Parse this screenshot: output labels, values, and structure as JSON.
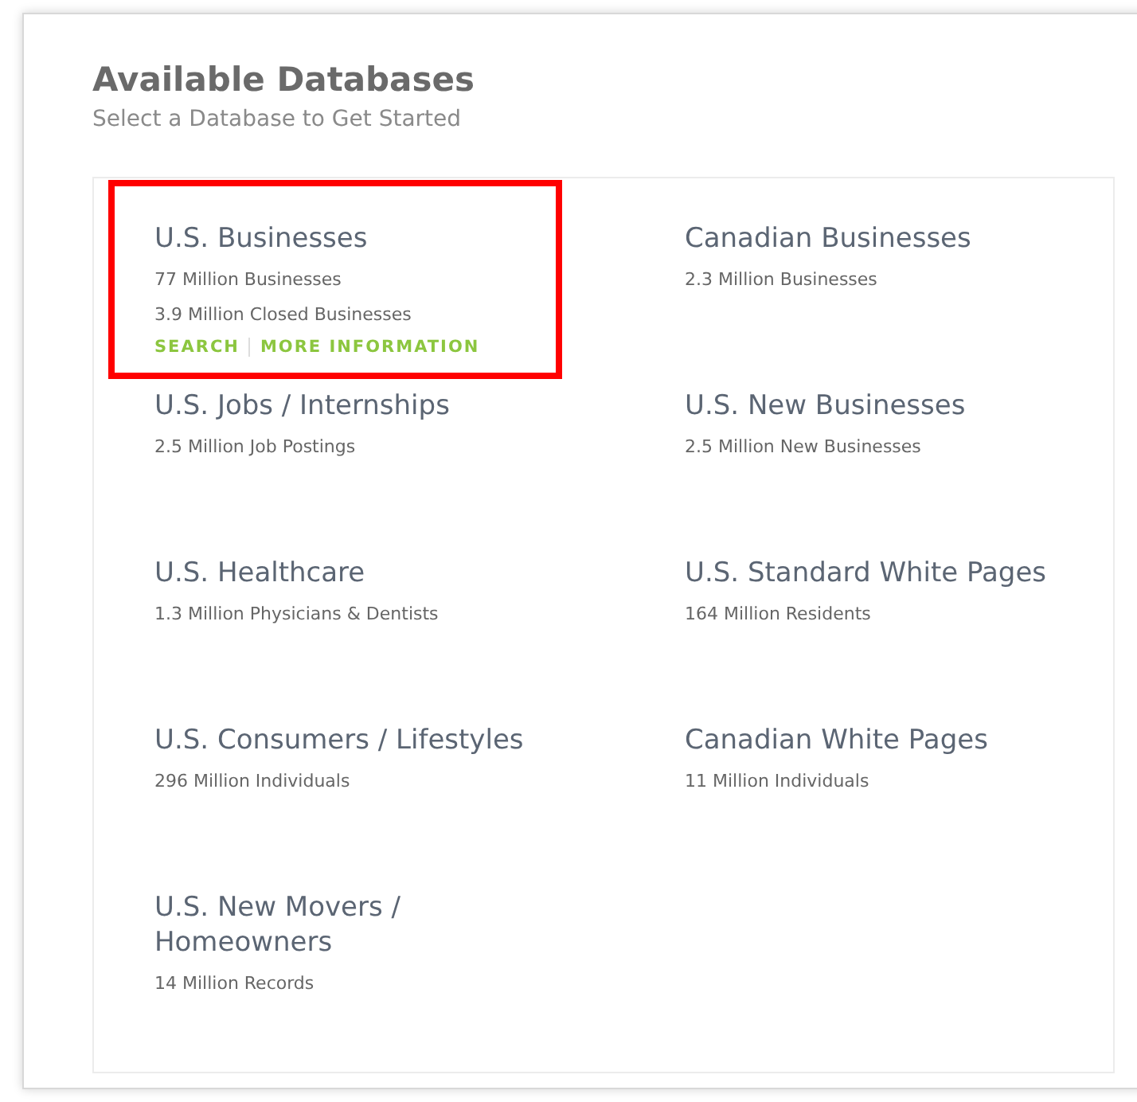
{
  "header": {
    "title": "Available Databases",
    "subtitle": "Select a Database to Get Started"
  },
  "databases": [
    {
      "title": "U.S. Businesses",
      "lines": [
        "77 Million Businesses",
        "3.9 Million Closed Businesses"
      ],
      "links": [
        "SEARCH",
        "MORE INFORMATION"
      ],
      "highlighted": true
    },
    {
      "title": "Canadian Businesses",
      "lines": [
        "2.3 Million Businesses"
      ],
      "highlighted": false
    },
    {
      "title": "U.S. Jobs / Internships",
      "lines": [
        "2.5 Million Job Postings"
      ],
      "highlighted": false
    },
    {
      "title": "U.S. New Businesses",
      "lines": [
        "2.5 Million New Businesses"
      ],
      "highlighted": false
    },
    {
      "title": "U.S. Healthcare",
      "lines": [
        "1.3 Million Physicians & Dentists"
      ],
      "highlighted": false
    },
    {
      "title": "U.S. Standard White Pages",
      "lines": [
        "164 Million Residents"
      ],
      "highlighted": false
    },
    {
      "title": "U.S. Consumers / Lifestyles",
      "lines": [
        "296 Million Individuals"
      ],
      "highlighted": false
    },
    {
      "title": "Canadian White Pages",
      "lines": [
        "11 Million Individuals"
      ],
      "highlighted": false
    },
    {
      "title": "U.S. New Movers / Homeowners",
      "lines": [
        "14 Million Records"
      ],
      "highlighted": false
    }
  ]
}
